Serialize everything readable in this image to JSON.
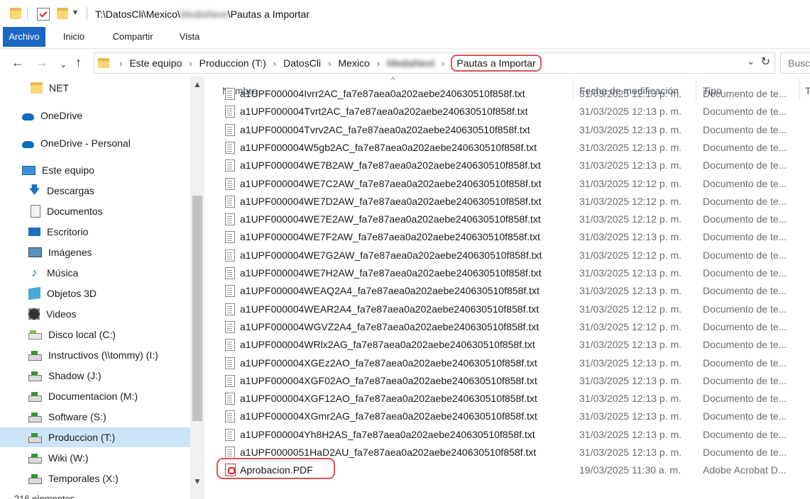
{
  "window": {
    "title_prefix": "T:\\DatosCli\\Mexico\\",
    "title_blurred": "MediaNext",
    "title_suffix": "\\Pautas a Importar"
  },
  "ribbon": {
    "tabs": [
      "Archivo",
      "Inicio",
      "Compartir",
      "Vista"
    ]
  },
  "address": {
    "crumbs": [
      "Este equipo",
      "Produccion (T:)",
      "DatosCli",
      "Mexico"
    ],
    "blurred": "MediaNext",
    "current": "Pautas a Importar",
    "search_placeholder": "Busc"
  },
  "nav": {
    "items": [
      {
        "label": "NET",
        "icon": "folder-icon"
      },
      {
        "label": "OneDrive",
        "icon": "onedrive-icon"
      },
      {
        "label": "OneDrive - Personal",
        "icon": "onedrive-icon"
      },
      {
        "label": "Este equipo",
        "icon": "this-pc-icon"
      },
      {
        "label": "Descargas",
        "icon": "downloads-icon"
      },
      {
        "label": "Documentos",
        "icon": "documents-icon"
      },
      {
        "label": "Escritorio",
        "icon": "desktop-icon"
      },
      {
        "label": "Imágenes",
        "icon": "pictures-icon"
      },
      {
        "label": "Música",
        "icon": "music-icon"
      },
      {
        "label": "Objetos 3D",
        "icon": "objects-3d-icon"
      },
      {
        "label": "Videos",
        "icon": "videos-icon"
      },
      {
        "label": "Disco local (C:)",
        "icon": "local-disk-icon"
      },
      {
        "label": "Instructivos (\\\\tommy) (I:)",
        "icon": "network-drive-icon"
      },
      {
        "label": "Shadow (J:)",
        "icon": "network-drive-icon"
      },
      {
        "label": "Documentacion (M:)",
        "icon": "network-drive-icon"
      },
      {
        "label": "Software (S:)",
        "icon": "network-drive-icon"
      },
      {
        "label": "Produccion (T:)",
        "icon": "network-drive-icon",
        "selected": true
      },
      {
        "label": "Wiki (W:)",
        "icon": "network-drive-icon"
      },
      {
        "label": "Temporales (X:)",
        "icon": "network-drive-icon"
      }
    ],
    "status": "216 elementos"
  },
  "columns": {
    "name": "Nombre",
    "date": "Fecha de modificación",
    "type": "Tipo",
    "extra": "T"
  },
  "files": [
    {
      "name": "a1UPF000004Ivrr2AC_fa7e87aea0a202aebe240630510f858f.txt",
      "date": "31/03/2025 12:13 p. m.",
      "type": "Documento de te..."
    },
    {
      "name": "a1UPF000004Tvrt2AC_fa7e87aea0a202aebe240630510f858f.txt",
      "date": "31/03/2025 12:13 p. m.",
      "type": "Documento de te..."
    },
    {
      "name": "a1UPF000004Tvrv2AC_fa7e87aea0a202aebe240630510f858f.txt",
      "date": "31/03/2025 12:13 p. m.",
      "type": "Documento de te..."
    },
    {
      "name": "a1UPF000004W5gb2AC_fa7e87aea0a202aebe240630510f858f.txt",
      "date": "31/03/2025 12:13 p. m.",
      "type": "Documento de te..."
    },
    {
      "name": "a1UPF000004WE7B2AW_fa7e87aea0a202aebe240630510f858f.txt",
      "date": "31/03/2025 12:13 p. m.",
      "type": "Documento de te..."
    },
    {
      "name": "a1UPF000004WE7C2AW_fa7e87aea0a202aebe240630510f858f.txt",
      "date": "31/03/2025 12:12 p. m.",
      "type": "Documento de te..."
    },
    {
      "name": "a1UPF000004WE7D2AW_fa7e87aea0a202aebe240630510f858f.txt",
      "date": "31/03/2025 12:12 p. m.",
      "type": "Documento de te..."
    },
    {
      "name": "a1UPF000004WE7E2AW_fa7e87aea0a202aebe240630510f858f.txt",
      "date": "31/03/2025 12:12 p. m.",
      "type": "Documento de te..."
    },
    {
      "name": "a1UPF000004WE7F2AW_fa7e87aea0a202aebe240630510f858f.txt",
      "date": "31/03/2025 12:13 p. m.",
      "type": "Documento de te..."
    },
    {
      "name": "a1UPF000004WE7G2AW_fa7e87aea0a202aebe240630510f858f.txt",
      "date": "31/03/2025 12:12 p. m.",
      "type": "Documento de te..."
    },
    {
      "name": "a1UPF000004WE7H2AW_fa7e87aea0a202aebe240630510f858f.txt",
      "date": "31/03/2025 12:13 p. m.",
      "type": "Documento de te..."
    },
    {
      "name": "a1UPF000004WEAQ2A4_fa7e87aea0a202aebe240630510f858f.txt",
      "date": "31/03/2025 12:13 p. m.",
      "type": "Documento de te..."
    },
    {
      "name": "a1UPF000004WEAR2A4_fa7e87aea0a202aebe240630510f858f.txt",
      "date": "31/03/2025 12:12 p. m.",
      "type": "Documento de te..."
    },
    {
      "name": "a1UPF000004WGVZ2A4_fa7e87aea0a202aebe240630510f858f.txt",
      "date": "31/03/2025 12:12 p. m.",
      "type": "Documento de te..."
    },
    {
      "name": "a1UPF000004WRlx2AG_fa7e87aea0a202aebe240630510f858f.txt",
      "date": "31/03/2025 12:13 p. m.",
      "type": "Documento de te..."
    },
    {
      "name": "a1UPF000004XGEz2AO_fa7e87aea0a202aebe240630510f858f.txt",
      "date": "31/03/2025 12:13 p. m.",
      "type": "Documento de te..."
    },
    {
      "name": "a1UPF000004XGF02AO_fa7e87aea0a202aebe240630510f858f.txt",
      "date": "31/03/2025 12:13 p. m.",
      "type": "Documento de te..."
    },
    {
      "name": "a1UPF000004XGF12AO_fa7e87aea0a202aebe240630510f858f.txt",
      "date": "31/03/2025 12:13 p. m.",
      "type": "Documento de te..."
    },
    {
      "name": "a1UPF000004XGmr2AG_fa7e87aea0a202aebe240630510f858f.txt",
      "date": "31/03/2025 12:13 p. m.",
      "type": "Documento de te..."
    },
    {
      "name": "a1UPF000004Yh8H2AS_fa7e87aea0a202aebe240630510f858f.txt",
      "date": "31/03/2025 12:13 p. m.",
      "type": "Documento de te..."
    },
    {
      "name": "a1UPF0000051HaD2AU_fa7e87aea0a202aebe240630510f858f.txt",
      "date": "31/03/2025 12:13 p. m.",
      "type": "Documento de te..."
    },
    {
      "name": "Aprobacion.PDF",
      "date": "19/03/2025 11:30 a. m.",
      "type": "Adobe Acrobat D...",
      "pdf": true
    }
  ],
  "colors": {
    "accent": "#1a66c2",
    "selection": "#cce4f7",
    "highlight": "#d9534f"
  }
}
